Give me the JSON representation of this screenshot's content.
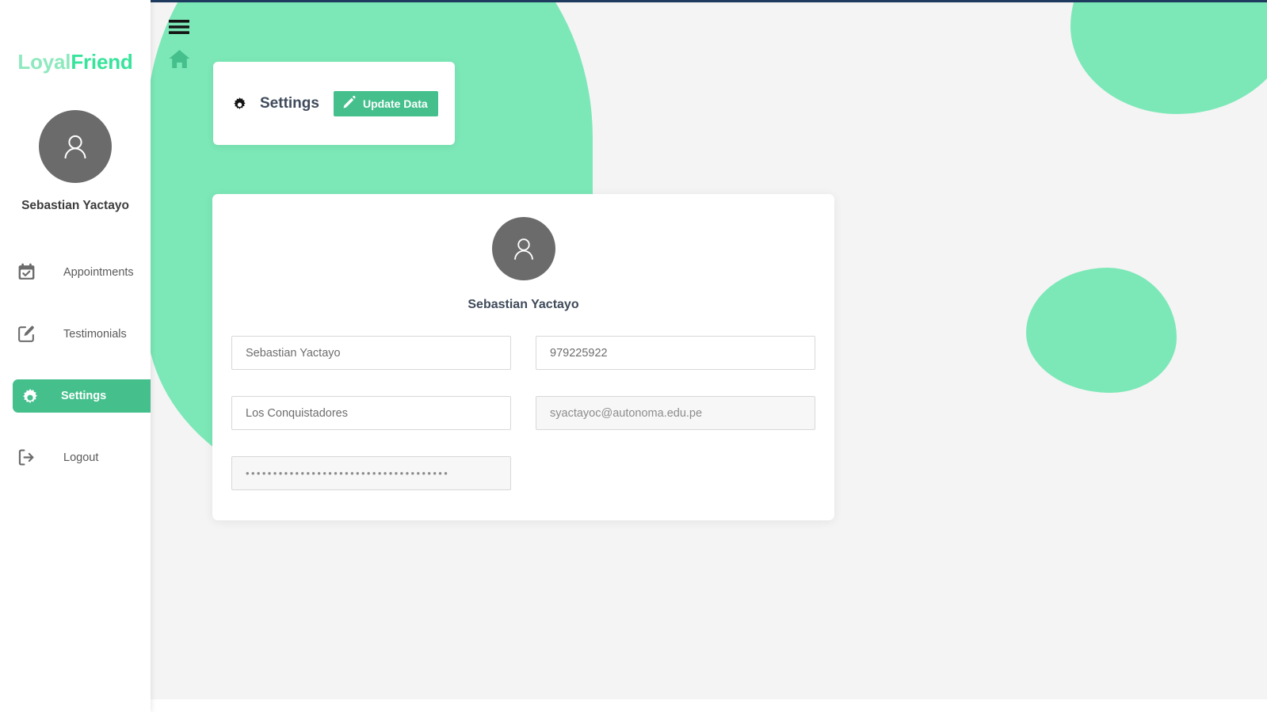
{
  "brand": {
    "part1": "Loyal",
    "part2": "Friend"
  },
  "colors": {
    "accent_green": "#45C08D",
    "blob_green": "#7CE8B7",
    "brand_light": "#8EE9BE",
    "brand_bright": "#38E49B",
    "avatar_gray": "#6b6b6b",
    "page_bg": "#f4f4f4",
    "top_strip": "#1f3a5f"
  },
  "sidebar": {
    "user_name": "Sebastian Yactayo",
    "avatar_icon": "user-icon",
    "items": [
      {
        "label": "Appointments",
        "icon": "calendar-check-icon",
        "active": false
      },
      {
        "label": "Testimonials",
        "icon": "pen-to-square-icon",
        "active": false
      },
      {
        "label": "Settings",
        "icon": "gear-icon",
        "active": true
      },
      {
        "label": "Logout",
        "icon": "sign-out-icon",
        "active": false
      }
    ]
  },
  "topbar": {
    "menu_icon": "hamburger-menu-icon",
    "home_icon": "home-icon"
  },
  "settings_card": {
    "gear_icon": "gear-icon",
    "title": "Settings",
    "button": {
      "label": "Update Data",
      "icon": "pencil-icon"
    }
  },
  "profile": {
    "avatar_icon": "user-icon",
    "name": "Sebastian Yactayo",
    "fields": [
      {
        "name": "full-name-field",
        "value": "Sebastian Yactayo",
        "placeholder": "Sebastian Yactayo",
        "readonly": false,
        "password": false
      },
      {
        "name": "phone-field",
        "value": "979225922",
        "placeholder": "979225922",
        "readonly": false,
        "password": false
      },
      {
        "name": "address-field",
        "value": "Los Conquistadores",
        "placeholder": "Los Conquistadores",
        "readonly": false,
        "password": false
      },
      {
        "name": "email-field",
        "value": "syactayoc@autonoma.edu.pe",
        "placeholder": "syactayoc@autonoma.edu.pe",
        "readonly": true,
        "password": false
      },
      {
        "name": "password-field",
        "value": "•••••••••••••••••••••••••••••••••••••",
        "placeholder": "•••••••••••••••••••••••••••••••••••••",
        "readonly": true,
        "password": true
      }
    ]
  }
}
